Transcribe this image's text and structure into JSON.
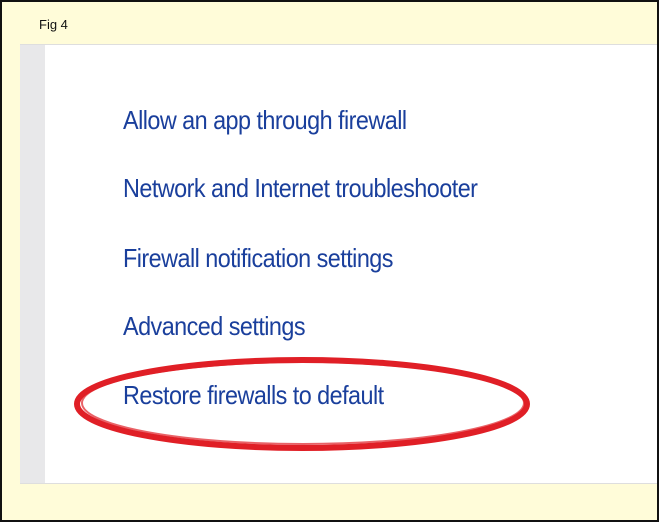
{
  "figure": {
    "label": "Fig 4"
  },
  "links": [
    {
      "label": "Allow an app through firewall"
    },
    {
      "label": "Network and Internet troubleshooter"
    },
    {
      "label": "Firewall notification settings"
    },
    {
      "label": "Advanced settings"
    },
    {
      "label": "Restore firewalls to default"
    }
  ],
  "annotation": {
    "highlight_color": "#e01f26",
    "highlighted_link": "Restore firewalls to default"
  },
  "colors": {
    "link": "#1a3f9c",
    "frame_background": "#fffcd9",
    "sidebar": "#e8e8ea"
  }
}
